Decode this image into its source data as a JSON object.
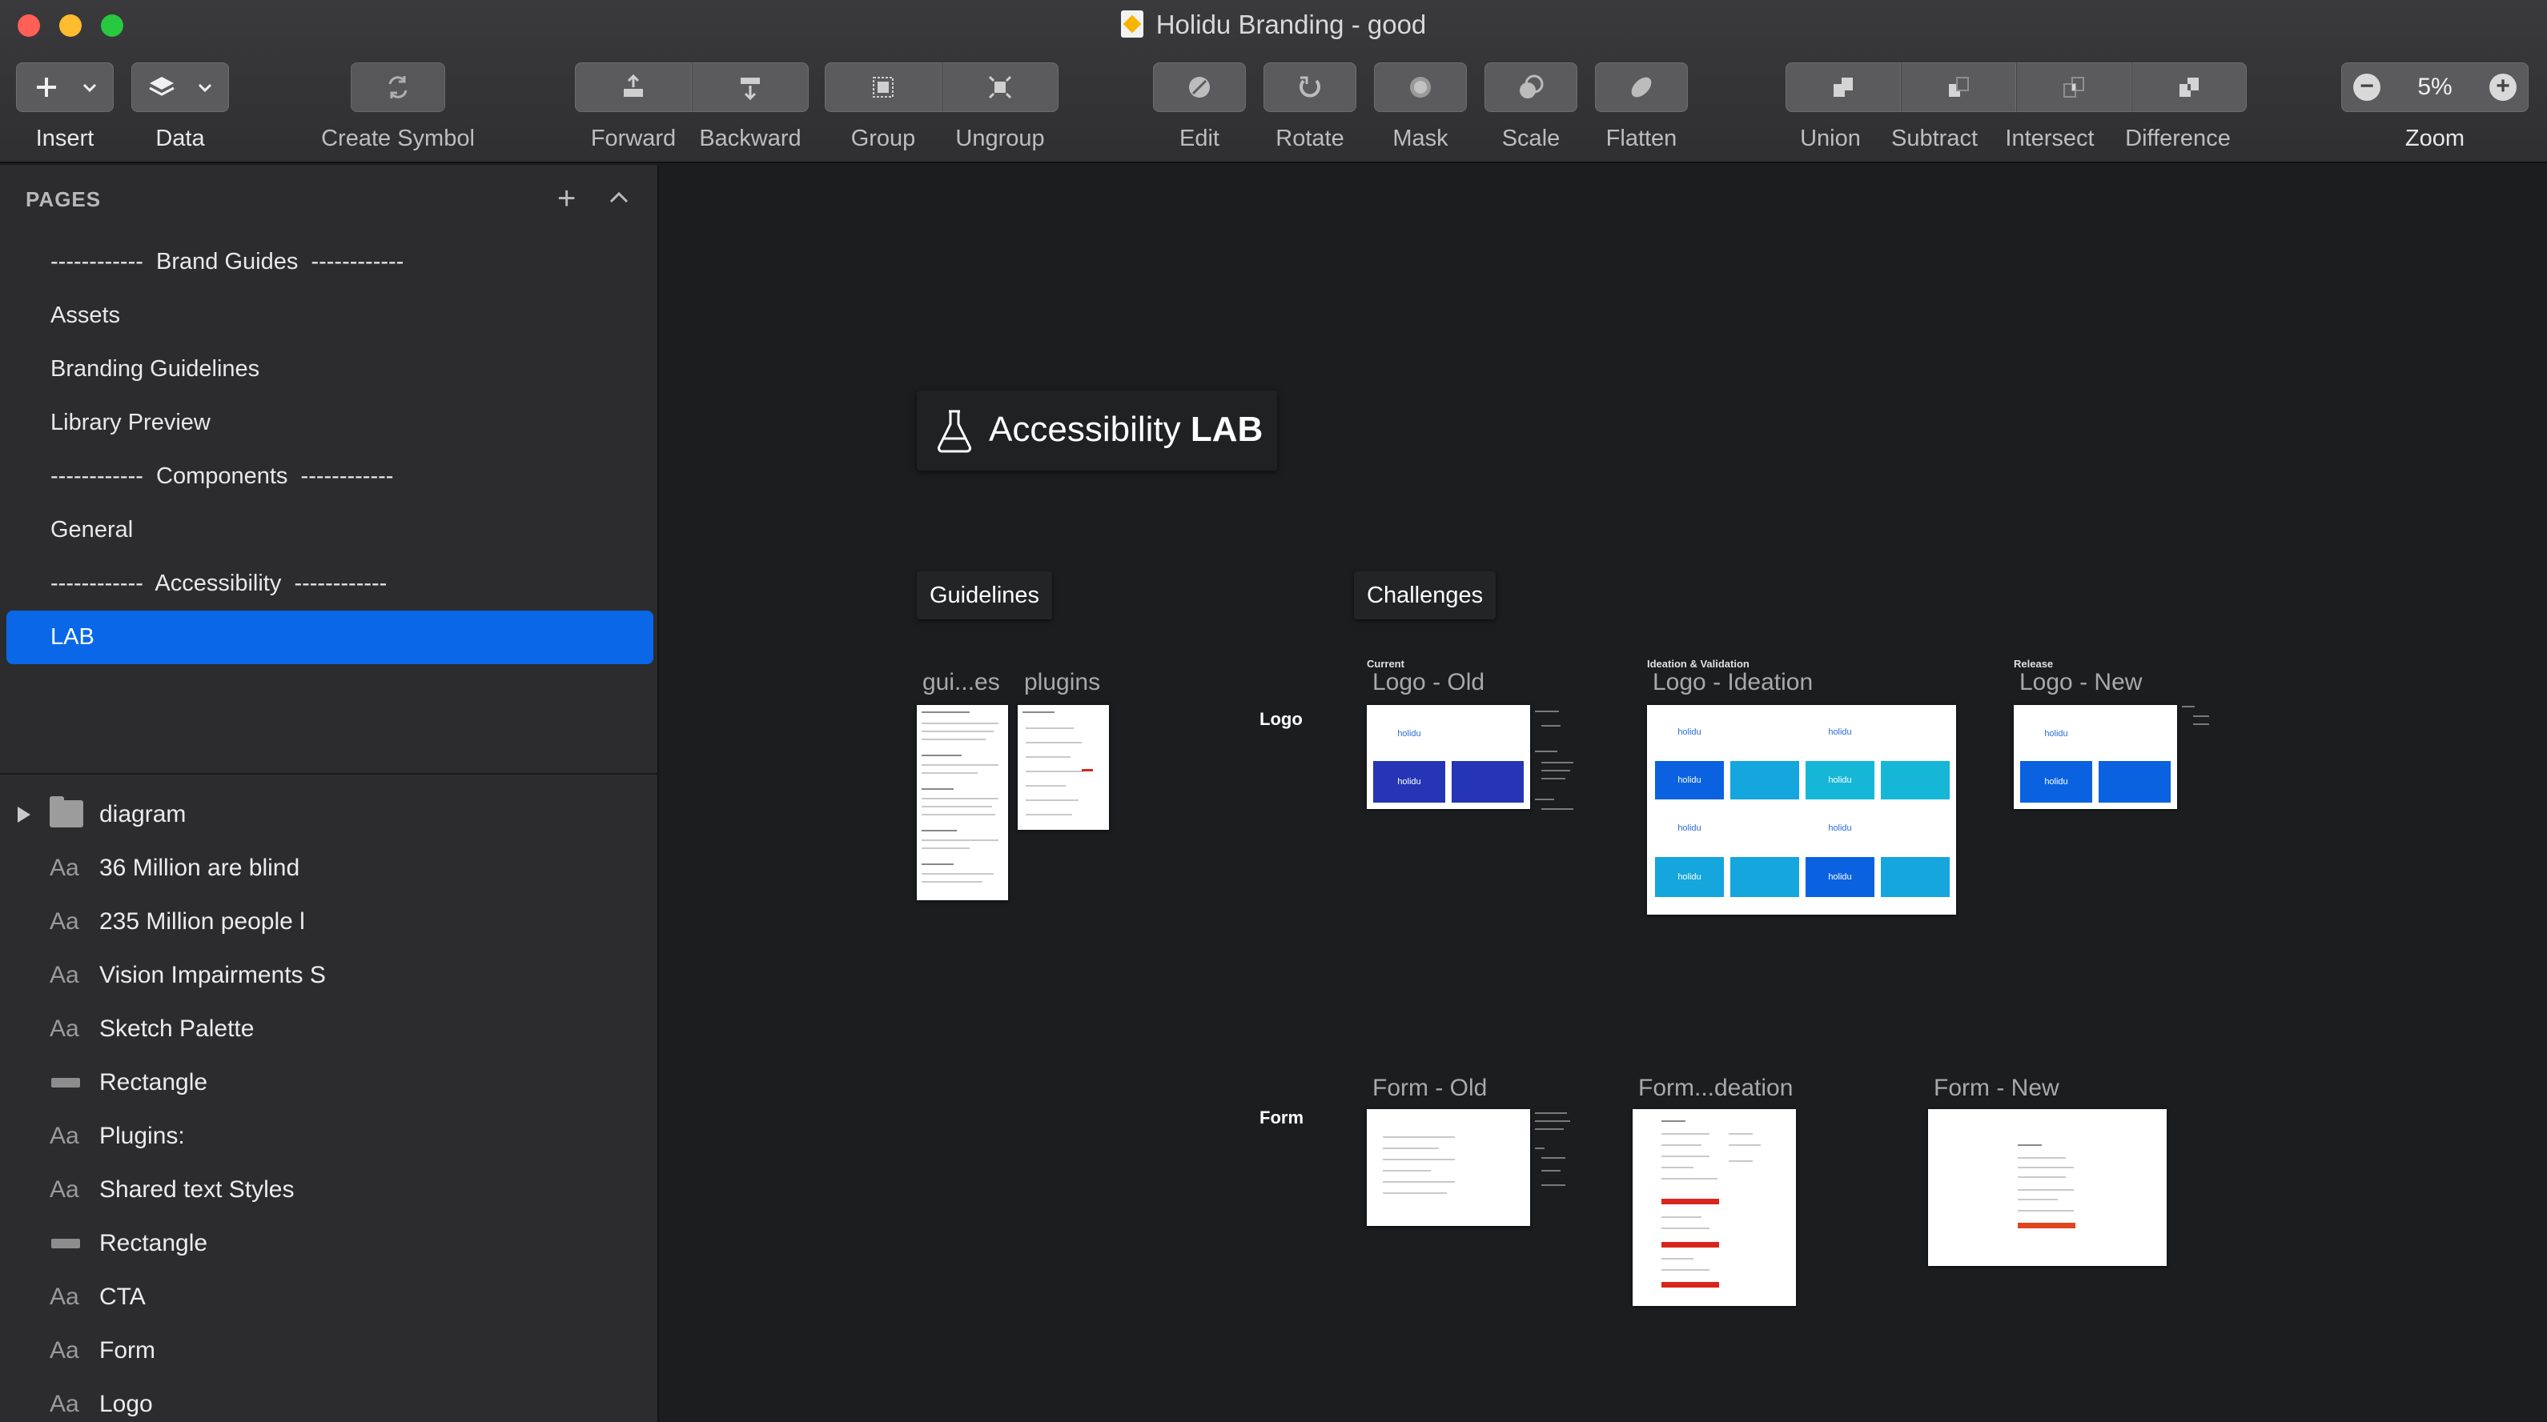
{
  "window": {
    "title": "Holidu Branding - good"
  },
  "toolbar": {
    "insert": "Insert",
    "data": "Data",
    "create_symbol": "Create Symbol",
    "forward": "Forward",
    "backward": "Backward",
    "group": "Group",
    "ungroup": "Ungroup",
    "edit": "Edit",
    "rotate": "Rotate",
    "mask": "Mask",
    "scale": "Scale",
    "flatten": "Flatten",
    "union": "Union",
    "subtract": "Subtract",
    "intersect": "Intersect",
    "difference": "Difference",
    "zoom_label": "Zoom",
    "zoom_value": "5%",
    "zoom_out": "−",
    "zoom_in": "+"
  },
  "sidebar": {
    "pages_header": "PAGES",
    "add": "+",
    "pages": [
      "------------  Brand Guides  ------------",
      "Assets",
      "Branding Guidelines",
      "Library Preview",
      "------------  Components  ------------",
      "General",
      "------------  Accessibility  ------------",
      "LAB"
    ],
    "active_page": "LAB",
    "layers": [
      {
        "type": "folder",
        "icon": "folder-icon",
        "label": "diagram"
      },
      {
        "type": "text",
        "icon": "Aa",
        "label": "36 Million are blind"
      },
      {
        "type": "text",
        "icon": "Aa",
        "label": "235 Million people l"
      },
      {
        "type": "text",
        "icon": "Aa",
        "label": "Vision Impairments S"
      },
      {
        "type": "text",
        "icon": "Aa",
        "label": "Sketch Palette"
      },
      {
        "type": "rect",
        "icon": "rectangle-icon",
        "label": "Rectangle"
      },
      {
        "type": "text",
        "icon": "Aa",
        "label": "Plugins:"
      },
      {
        "type": "text",
        "icon": "Aa",
        "label": "Shared text Styles"
      },
      {
        "type": "rect",
        "icon": "rectangle-icon",
        "label": "Rectangle"
      },
      {
        "type": "text",
        "icon": "Aa",
        "label": "CTA"
      },
      {
        "type": "text",
        "icon": "Aa",
        "label": "Form"
      },
      {
        "type": "text",
        "icon": "Aa",
        "label": "Logo"
      }
    ]
  },
  "canvas": {
    "title_regular": "Accessibility ",
    "title_bold": "LAB",
    "guidelines": "Guidelines",
    "challenges": "Challenges",
    "row_logo": "Logo",
    "row_form": "Form",
    "artboards": {
      "guides": "gui...es",
      "plugins": "plugins",
      "logo_old": "Logo - Old",
      "logo_ideation": "Logo - Ideation",
      "logo_new": "Logo - New",
      "form_old": "Form - Old",
      "form_ideation": "Form...deation",
      "form_new": "Form - New"
    },
    "mini_labels": {
      "current": "Current",
      "ideation": "Ideation & Validation",
      "release": "Release"
    },
    "logo_text": "holidu"
  },
  "colors": {
    "accent": "#0a67e8",
    "logo_blue": "#0a62e0",
    "logo_cyan": "#14a6dc",
    "cta_red": "#d8261e"
  }
}
